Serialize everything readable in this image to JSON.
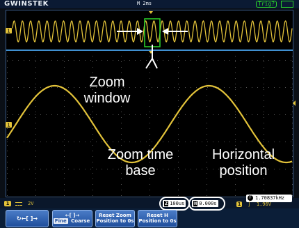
{
  "topbar": {
    "brand": "GWINSTEK",
    "timebase": "M 2ms",
    "trigger_status": "Trig?"
  },
  "channel1": {
    "label": "1",
    "scale": "2V",
    "color": "#e3c33a"
  },
  "readouts": {
    "zoom_time_base": "100us",
    "zoom_time_base_icon": "Z",
    "horizontal_position": "0.000s",
    "horizontal_position_icon": "H",
    "frequency": "1.70837kHz",
    "frequency_icon": "F",
    "trigger_channel": "1",
    "trigger_slope_symbol": "∫",
    "trigger_level": "1.96V"
  },
  "softkeys": [
    {
      "id": "scroll",
      "line1": "↻←[ ]→",
      "line2": ""
    },
    {
      "id": "fine-coarse",
      "line1": "←[ ]→",
      "opt_selected": "Fine",
      "opt_other": "Coarse"
    },
    {
      "id": "reset-zoom",
      "line1": "Reset Zoom",
      "line2": "Position to 0s"
    },
    {
      "id": "reset-h",
      "line1": "Reset H",
      "line2": "Position to 0s"
    }
  ],
  "annotations": {
    "zoom_window": [
      "Zoom",
      "window"
    ],
    "zoom_time_base": [
      "Zoom time",
      "base"
    ],
    "horizontal_position": [
      "Horizontal",
      "position"
    ]
  },
  "colors": {
    "trace": "#e3c33a",
    "frame": "#3a5c8c",
    "softkey": "#2d63b3",
    "zoom_box": "#2bd52b"
  }
}
